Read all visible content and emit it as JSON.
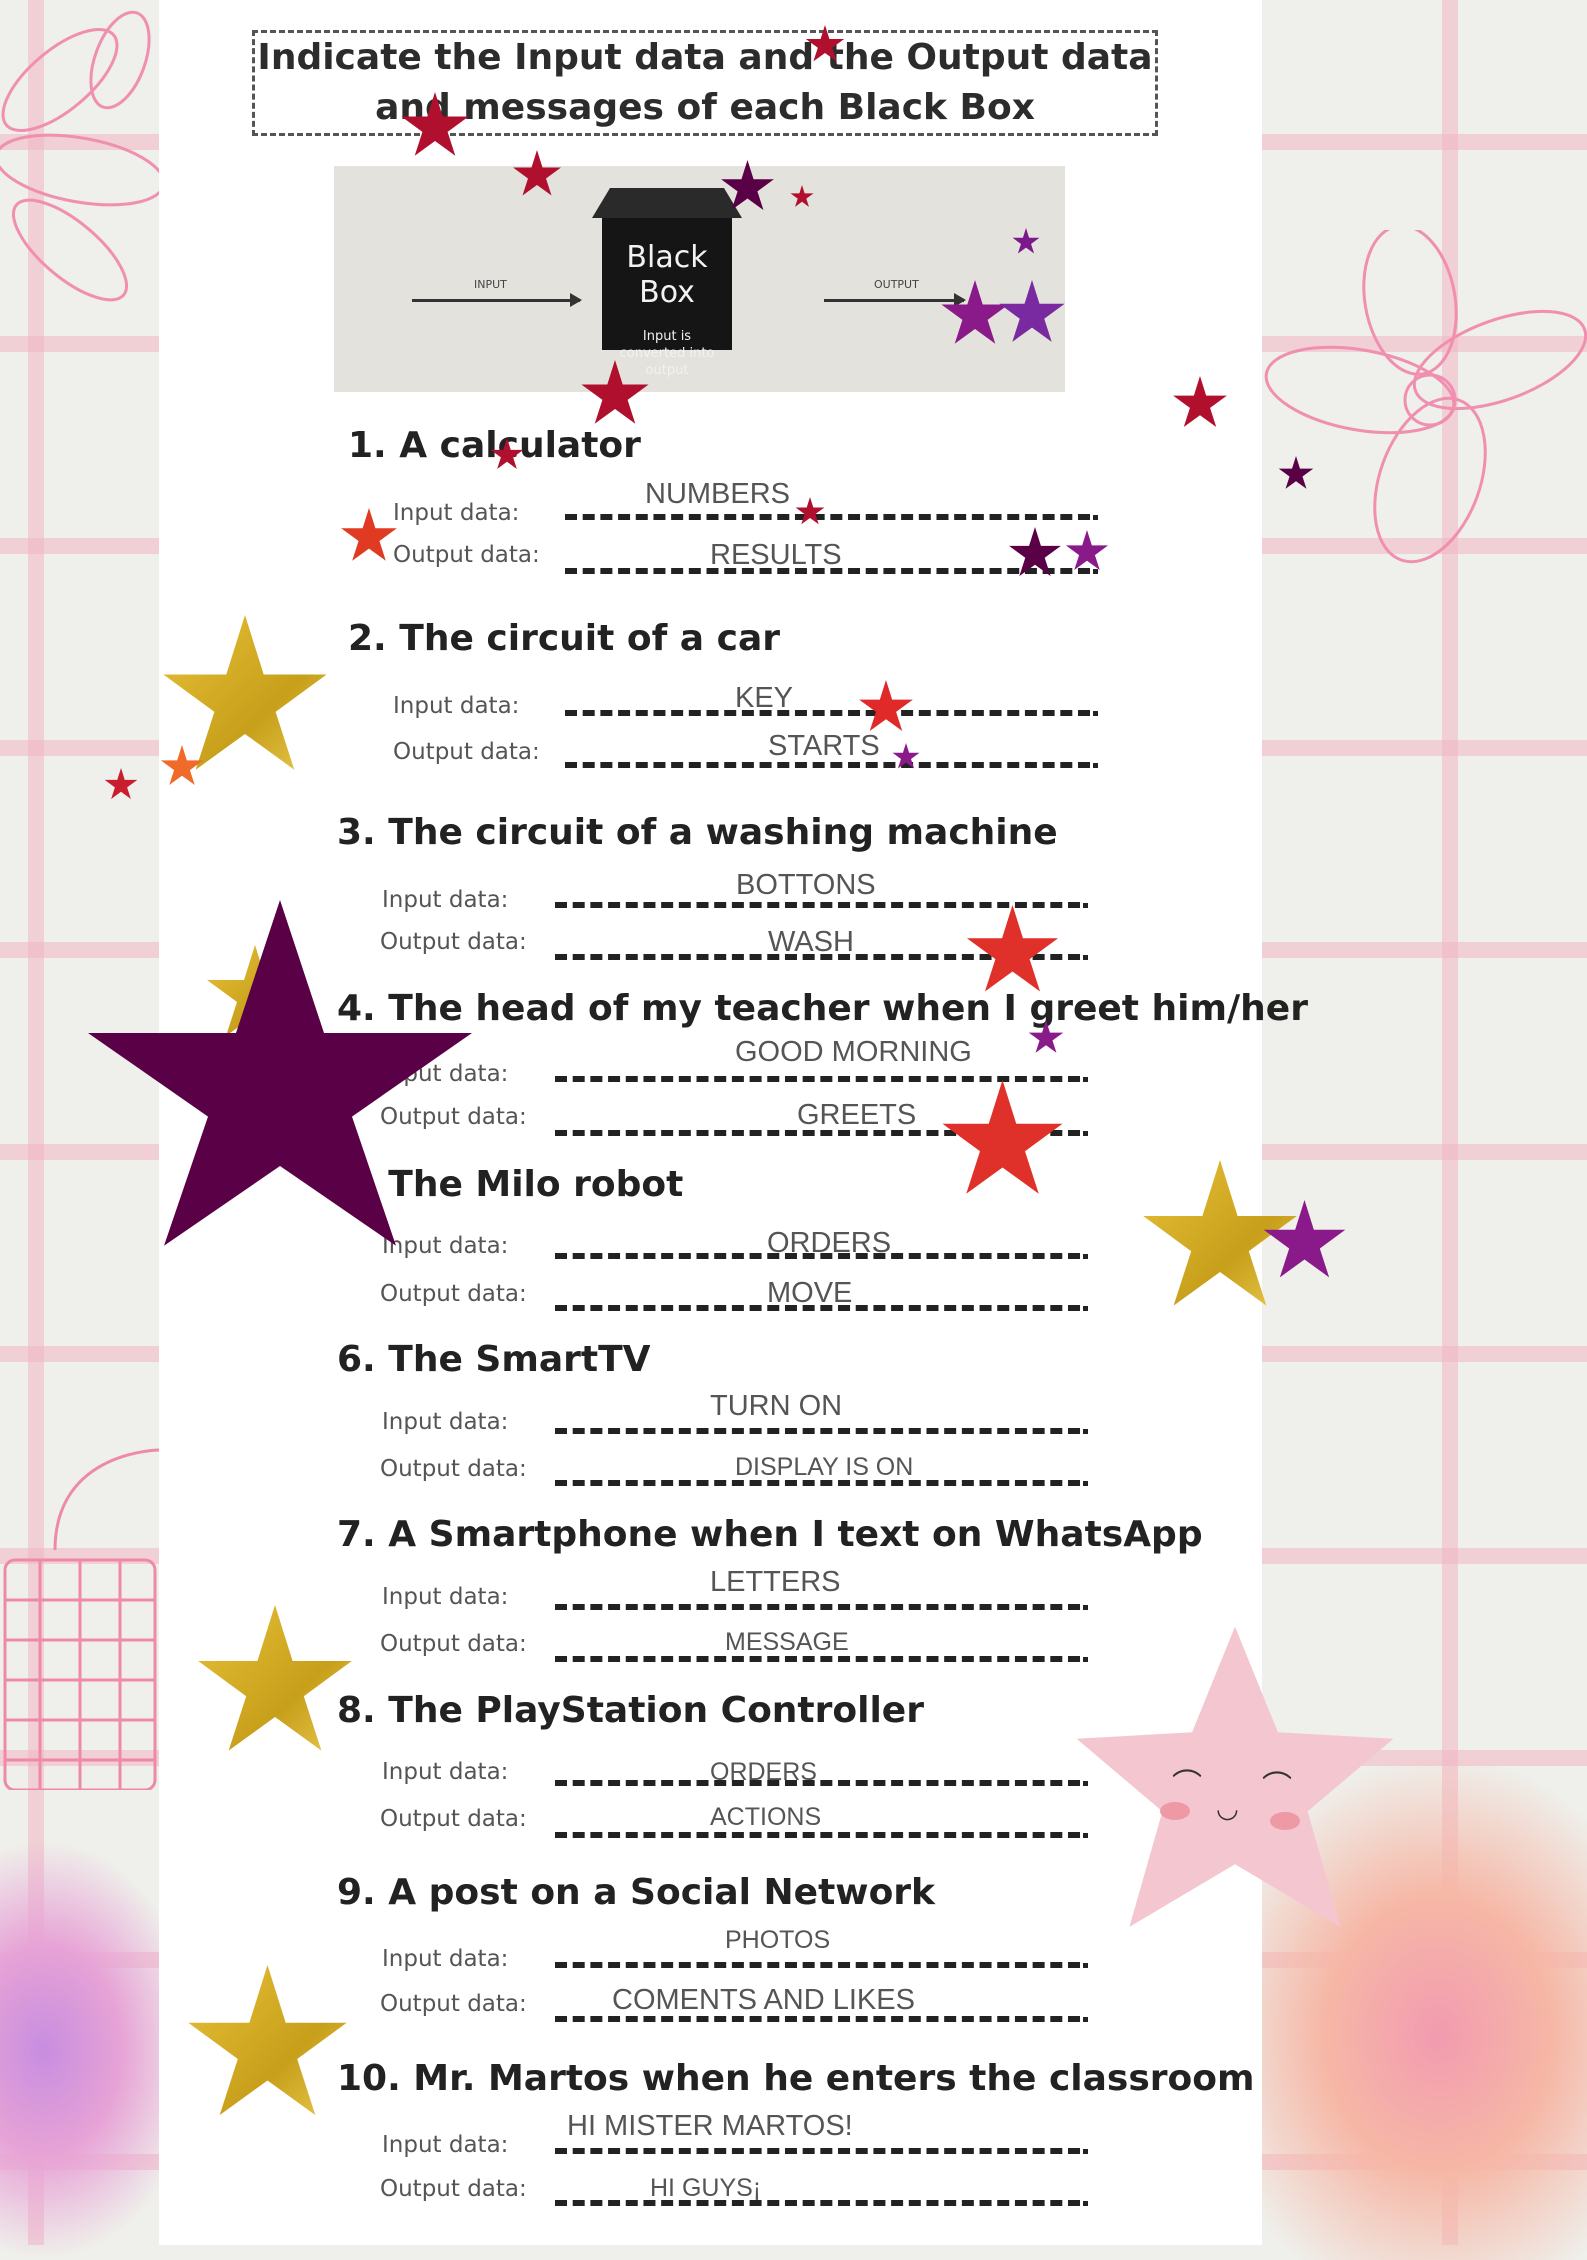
{
  "header": {
    "title": "Indicate the Input data and the Output data and messages of each Black Box"
  },
  "diagram": {
    "box_title": "Black Box",
    "box_subtitle": "Input is converted into output",
    "input_label": "INPUT",
    "output_label": "OUTPUT"
  },
  "labels": {
    "input": "Input data:",
    "output": "Output data:"
  },
  "items": [
    {
      "title": "1. A calculator",
      "input": "NUMBERS",
      "output": "RESULTS"
    },
    {
      "title": "2. The circuit of a car",
      "input": "KEY",
      "output": "STARTS"
    },
    {
      "title": "3. The circuit of a washing machine",
      "input": "BOTTONS",
      "output": "WASH"
    },
    {
      "title": "4. The head of my teacher when I greet him/her",
      "input": "GOOD MORNING",
      "output": "GREETS"
    },
    {
      "title": "5. The Milo robot",
      "input": "ORDERS",
      "output": "MOVE"
    },
    {
      "title": "6. The SmartTV",
      "input": "TURN ON",
      "output": "DISPLAY IS ON"
    },
    {
      "title": "7. A Smartphone when I text on WhatsApp",
      "input": "LETTERS",
      "output": "MESSAGE"
    },
    {
      "title": "8. The PlayStation Controller",
      "input": "ORDERS",
      "output": "ACTIONS"
    },
    {
      "title": "9. A post on a Social Network",
      "input": "PHOTOS",
      "output": "COMENTS AND LIKES"
    },
    {
      "title": "10. Mr. Martos when he enters the classroom",
      "input": "HI MISTER MARTOS!",
      "output": "HI GUYS¡"
    }
  ],
  "colors": {
    "grid": "#f0b4c3",
    "dark_purple": "#5a0046",
    "crimson": "#b0102e",
    "red": "#e03a23",
    "violet": "#8a1a8a",
    "gold": "#d8b22c"
  }
}
